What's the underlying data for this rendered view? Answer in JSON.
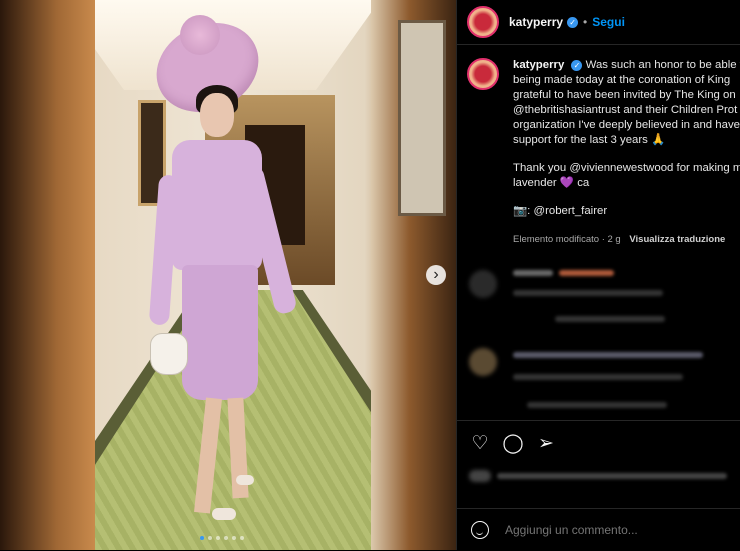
{
  "post": {
    "username": "katyperry",
    "separator": "•",
    "follow_label": "Segui"
  },
  "caption": {
    "username": "katyperry",
    "lines": [
      "Was such an honor to be able to",
      "being made today at the coronation of King",
      "grateful to have been invited by The King on",
      "@thebritishasiantrust and their Children Prot",
      "organization I've deeply believed in and have",
      "support for the last 3 years 🙏",
      "",
      "Thank you @viviennewestwood for making m",
      "lavender 💜 ca",
      "",
      "📷: @robert_fairer"
    ],
    "edited": "Elemento modificato · 2 g",
    "translate": "Visualizza traduzione"
  },
  "carousel": {
    "next_icon": "chevron-right-icon",
    "next_glyph": "›",
    "slides": 6,
    "active_index": 0
  },
  "actions": {
    "like_icon": "heart-icon",
    "comment_icon": "comment-icon",
    "share_icon": "share-icon"
  },
  "comment_box": {
    "placeholder": "Aggiungi un commento...",
    "emoji_icon": "emoji-icon"
  },
  "colors": {
    "accent": "#0095f6",
    "verified": "#3897f0",
    "background": "#000000"
  }
}
